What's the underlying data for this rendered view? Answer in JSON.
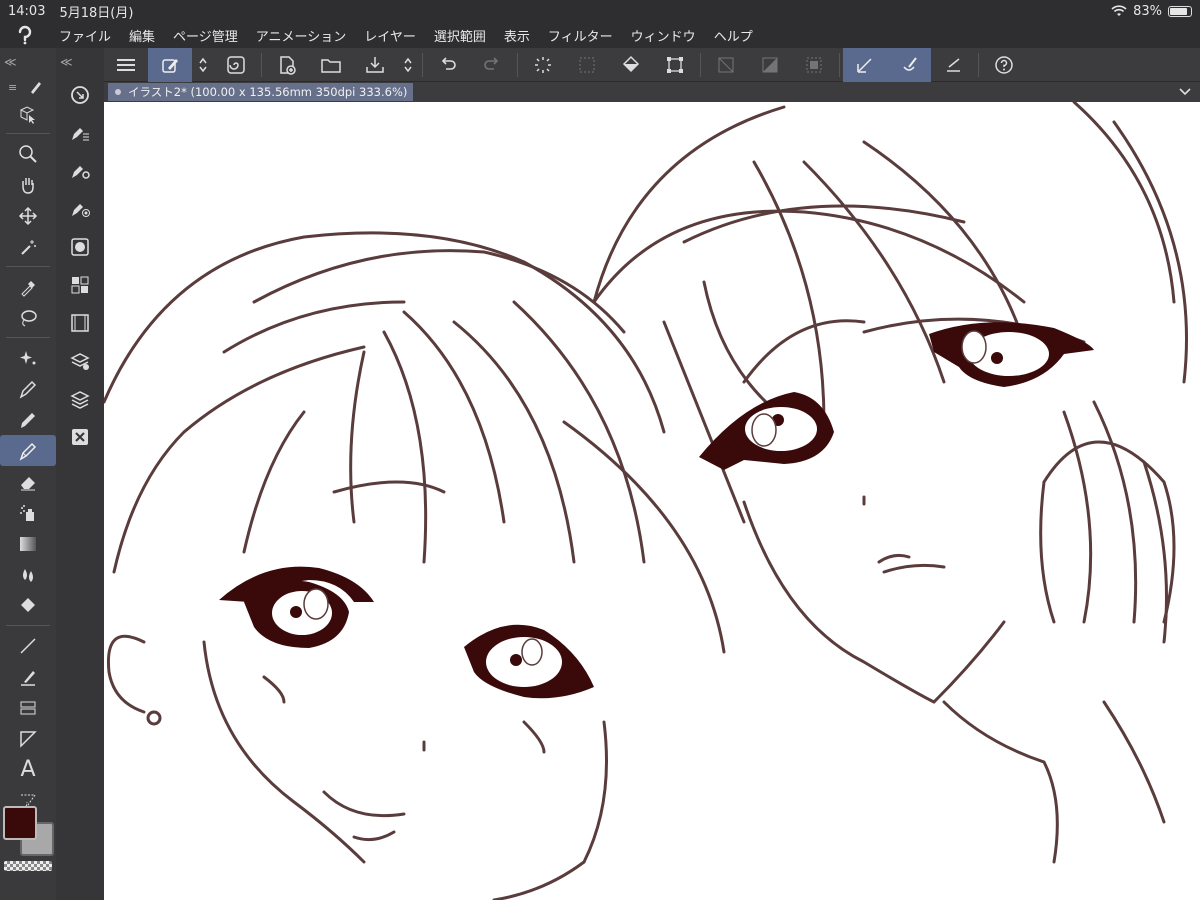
{
  "status": {
    "time": "14:03",
    "date": "5月18日(月)",
    "wifi": "wifi-icon",
    "battery_text": "83%",
    "battery_level": 0.83
  },
  "menu": {
    "items": [
      "ファイル",
      "編集",
      "ページ管理",
      "アニメーション",
      "レイヤー",
      "選択範囲",
      "表示",
      "フィルター",
      "ウィンドウ",
      "ヘルプ"
    ]
  },
  "document": {
    "tab_title": "イラスト2* (100.00 x 135.56mm 350dpi 333.6%)"
  },
  "colors": {
    "accent": "#5a6a8e",
    "main_color": "#3a0a0a",
    "sub_color": "#a8a8a8",
    "line_art": "#4a2e2e"
  }
}
